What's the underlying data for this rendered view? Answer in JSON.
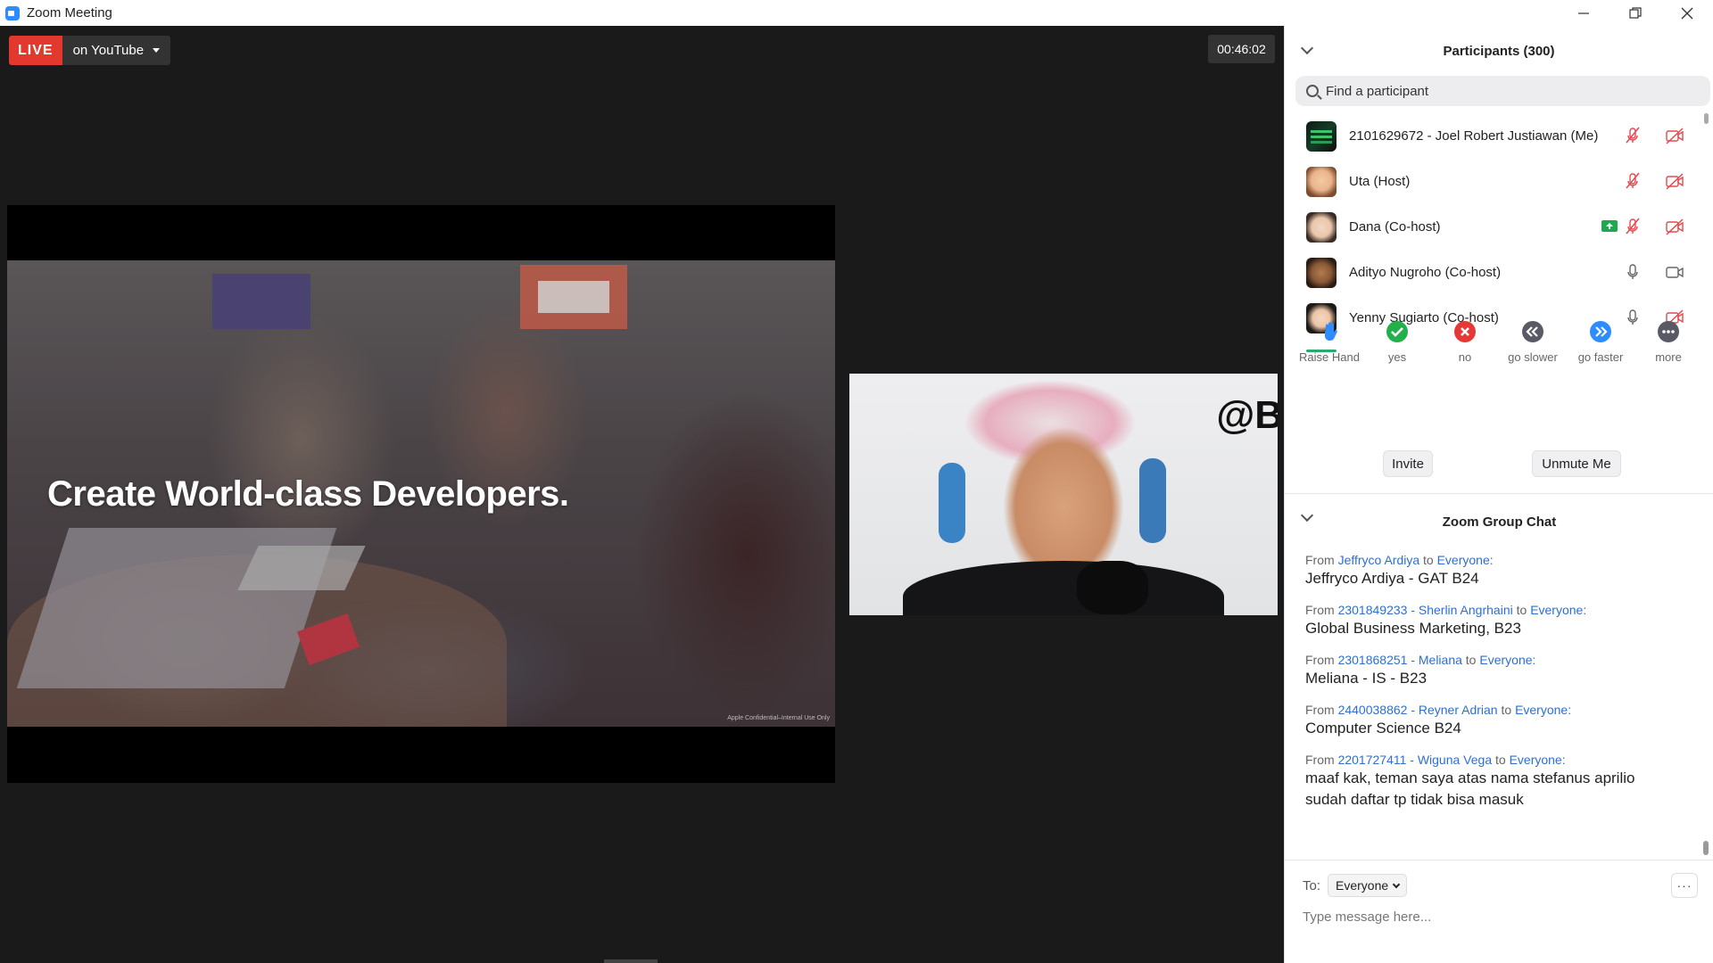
{
  "window": {
    "title": "Zoom Meeting",
    "controls": [
      "minimize",
      "restore",
      "close"
    ]
  },
  "stage": {
    "live_badge": "LIVE",
    "live_target": "on YouTube",
    "timer": "00:46:02",
    "slide_text": "Create World-class Developers.",
    "slide_footer": "Apple Confidential–Internal Use Only",
    "camera_watermark": "@B"
  },
  "participants": {
    "title": "Participants (300)",
    "search_placeholder": "Find a participant",
    "list": [
      {
        "name": "2101629672 - Joel Robert Justiawan (Me)",
        "mic": "muted",
        "camera": "off",
        "sharing": false
      },
      {
        "name": "Uta (Host)",
        "mic": "muted",
        "camera": "off",
        "sharing": false
      },
      {
        "name": "Dana (Co-host)",
        "mic": "muted",
        "camera": "off",
        "sharing": true
      },
      {
        "name": "Adityo Nugroho (Co-host)",
        "mic": "on",
        "camera": "on",
        "sharing": false
      },
      {
        "name": "Yenny Sugiarto (Co-host)",
        "mic": "on",
        "camera": "off",
        "sharing": false
      }
    ],
    "reactions": [
      {
        "label": "Raise Hand",
        "icon": "raise-hand-icon",
        "color": "#2d8cff"
      },
      {
        "label": "yes",
        "icon": "check-icon",
        "color": "#22b04b"
      },
      {
        "label": "no",
        "icon": "x-icon",
        "color": "#e53935"
      },
      {
        "label": "go slower",
        "icon": "rewind-icon",
        "color": "#5a5a66"
      },
      {
        "label": "go faster",
        "icon": "fast-forward-icon",
        "color": "#2d8cff"
      },
      {
        "label": "more",
        "icon": "ellipsis-icon",
        "color": "#5a5a66"
      }
    ],
    "invite_label": "Invite",
    "unmute_label": "Unmute Me"
  },
  "chat": {
    "title": "Zoom Group Chat",
    "from_word": "From",
    "to_word": "to",
    "messages": [
      {
        "from": "Jeffryco Ardiya",
        "to": "Everyone:",
        "text": "Jeffryco Ardiya - GAT B24"
      },
      {
        "from": "2301849233 - Sherlin Angrhaini",
        "to": "Everyone:",
        "text": "Global Business Marketing, B23"
      },
      {
        "from": "2301868251 - Meliana",
        "to": "Everyone:",
        "text": "Meliana - IS - B23"
      },
      {
        "from": "2440038862 - Reyner Adrian",
        "to": "Everyone:",
        "text": "Computer Science B24"
      },
      {
        "from": "2201727411 - Wiguna Vega",
        "to": "Everyone:",
        "text": "maaf kak, teman saya atas nama stefanus aprilio sudah daftar tp tidak bisa masuk"
      }
    ],
    "to_label": "To:",
    "to_value": "Everyone",
    "more_label": "···",
    "compose_placeholder": "Type message here..."
  }
}
